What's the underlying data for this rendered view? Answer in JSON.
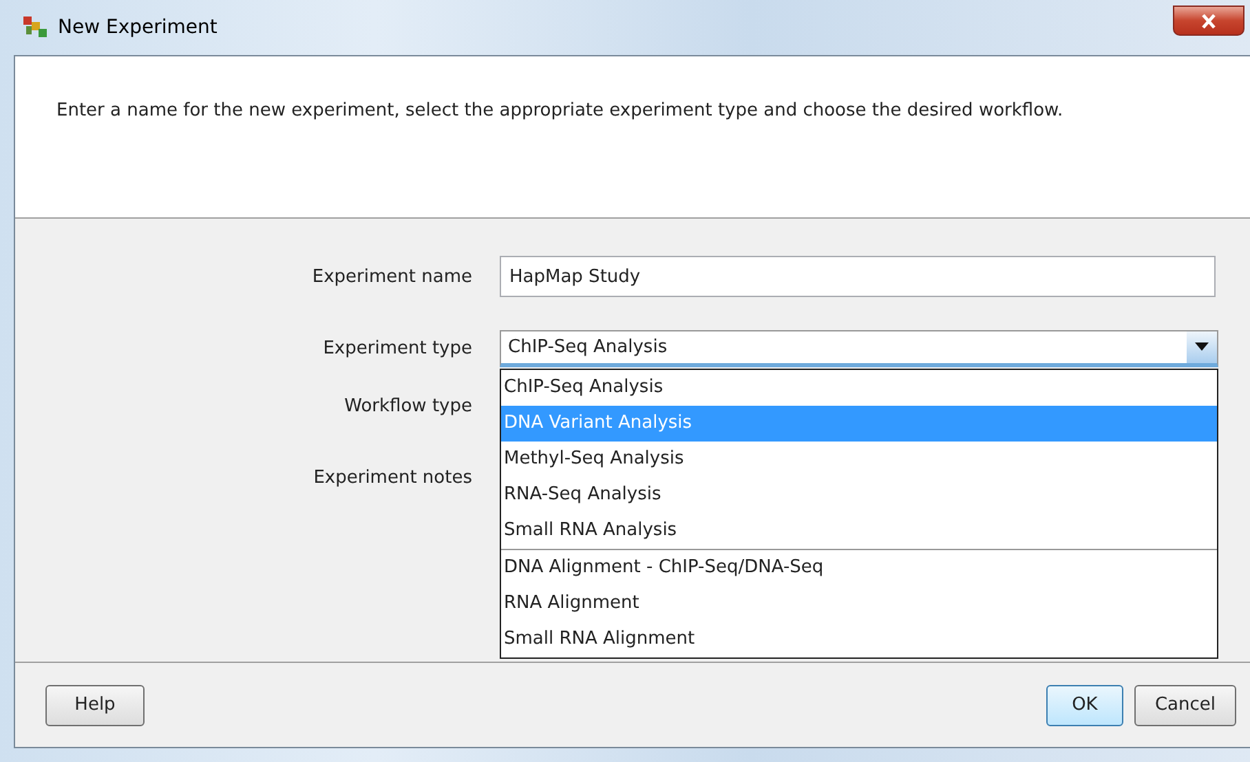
{
  "window": {
    "title": "New Experiment"
  },
  "intro": "Enter a name for the new experiment, select the appropriate experiment type and choose the desired workflow.",
  "experiment_name": {
    "label": "Experiment name",
    "value": "HapMap Study"
  },
  "experiment_type": {
    "label": "Experiment type",
    "value": "ChIP-Seq Analysis",
    "expanded": true,
    "option_groups": [
      [
        {
          "label": "ChIP-Seq Analysis",
          "selected": false
        },
        {
          "label": "DNA Variant Analysis",
          "selected": true
        },
        {
          "label": "Methyl-Seq Analysis",
          "selected": false
        },
        {
          "label": "RNA-Seq Analysis",
          "selected": false
        },
        {
          "label": "Small RNA Analysis",
          "selected": false
        }
      ],
      [
        {
          "label": "DNA Alignment - ChIP-Seq/DNA-Seq",
          "selected": false
        },
        {
          "label": "RNA Alignment",
          "selected": false
        },
        {
          "label": "Small RNA Alignment",
          "selected": false
        }
      ]
    ]
  },
  "workflow_type": {
    "label": "Workflow type"
  },
  "experiment_notes": {
    "label": "Experiment notes"
  },
  "buttons": {
    "left": [
      "Help"
    ],
    "right": [
      {
        "label": "OK",
        "default": true
      },
      {
        "label": "Cancel",
        "default": false
      }
    ]
  }
}
